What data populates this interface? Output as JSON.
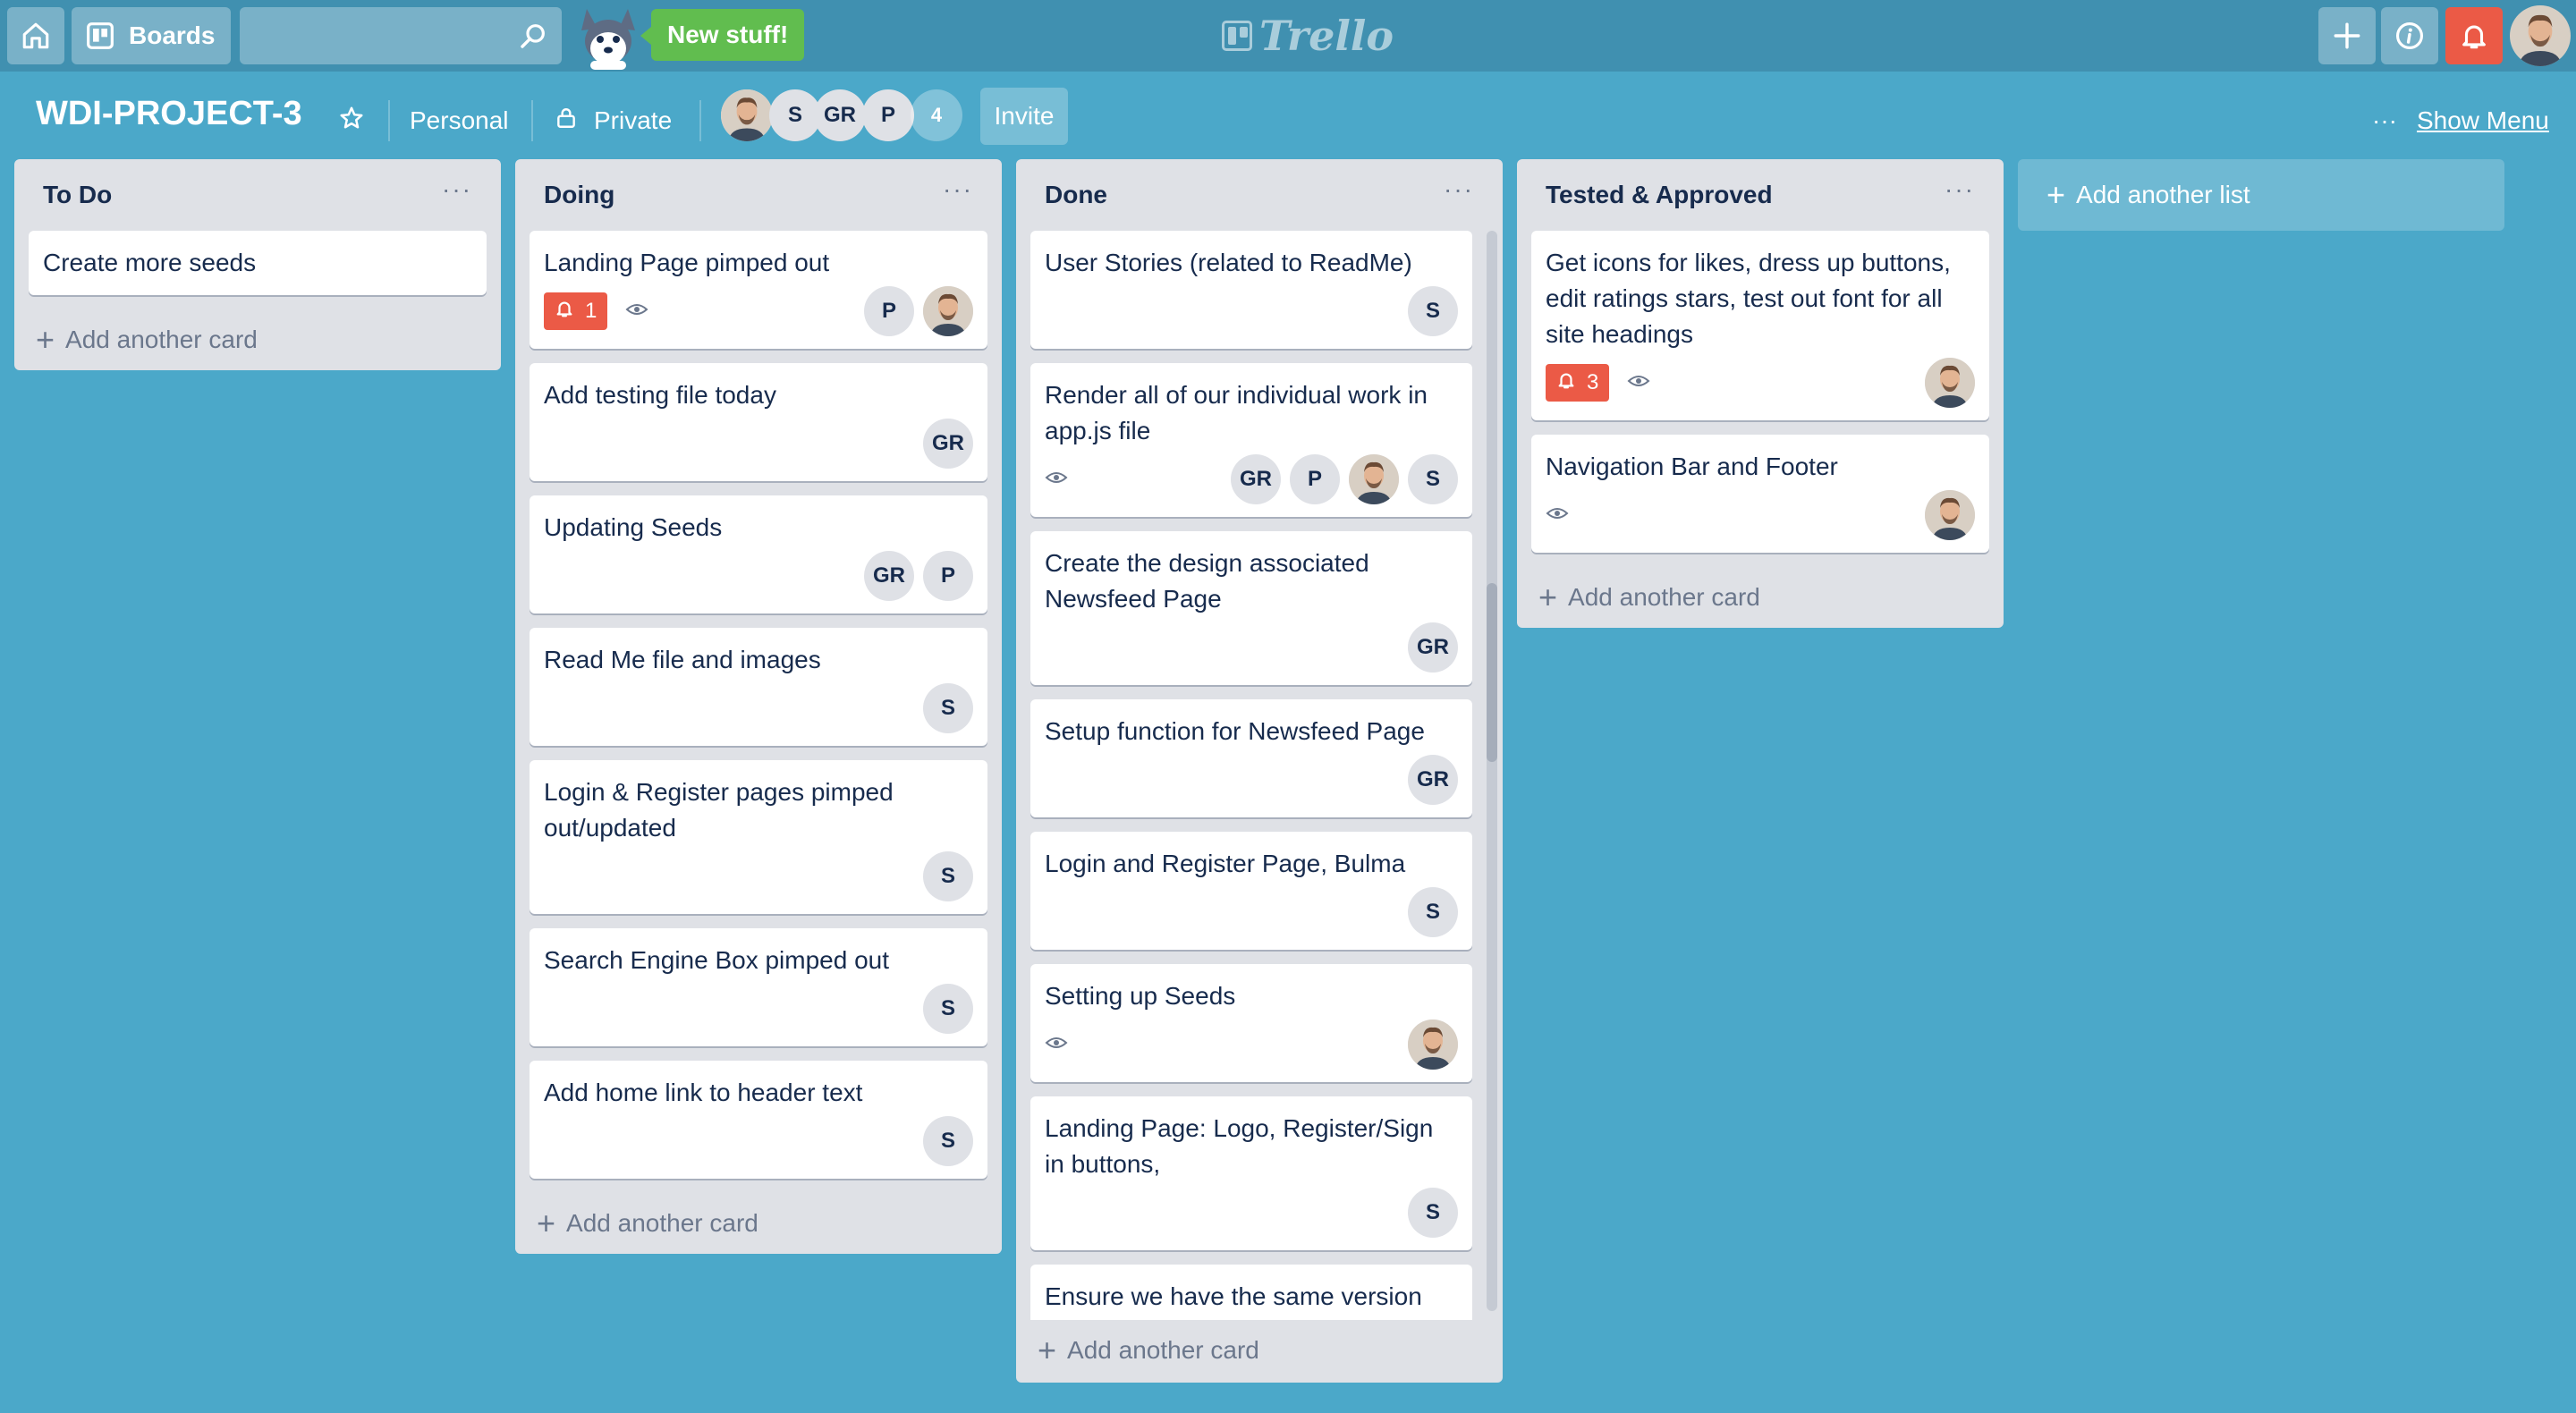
{
  "header": {
    "boards_label": "Boards",
    "search_value": "",
    "new_stuff_label": "New stuff!",
    "logo_text": "Trello",
    "icons": [
      "home-icon",
      "boards-icon",
      "search-icon",
      "plus-icon",
      "info-icon",
      "bell-icon"
    ]
  },
  "board": {
    "title": "WDI-PROJECT-3",
    "team": "Personal",
    "visibility": "Private",
    "members": [
      "S",
      "GR",
      "P"
    ],
    "member_count": "4",
    "invite_label": "Invite",
    "menu_dots": "···",
    "show_menu_label": "Show Menu"
  },
  "colors": {
    "background": "#4ba8c9",
    "header": "#4090b0",
    "list_bg": "#dfe1e6",
    "badge_red": "#eb5a46",
    "new_stuff_green": "#61bd4f"
  },
  "common": {
    "add_card_label": "Add another card",
    "add_list_label": "Add another list",
    "list_menu": "···"
  },
  "lists": [
    {
      "title": "To Do",
      "cards": [
        {
          "title": "Create more seeds"
        }
      ]
    },
    {
      "title": "Doing",
      "cards": [
        {
          "title": "Landing Page pimped out",
          "notif": "1",
          "watch": true,
          "members": [
            "P",
            "photo"
          ]
        },
        {
          "title": "Add testing file today",
          "members": [
            "GR"
          ]
        },
        {
          "title": "Updating Seeds",
          "members": [
            "GR",
            "P"
          ]
        },
        {
          "title": "Read Me file and images",
          "members": [
            "S"
          ]
        },
        {
          "title": "Login & Register pages pimped out/updated",
          "members": [
            "S"
          ]
        },
        {
          "title": "Search Engine Box pimped out",
          "members": [
            "S"
          ]
        },
        {
          "title": "Add home link to header text",
          "members": [
            "S"
          ]
        }
      ]
    },
    {
      "title": "Done",
      "cards": [
        {
          "title": "User Stories (related to ReadMe)",
          "members": [
            "S"
          ]
        },
        {
          "title": "Render all of our individual work in app.js file",
          "watch": true,
          "members": [
            "GR",
            "P",
            "photo",
            "S"
          ]
        },
        {
          "title": "Create the design associated Newsfeed Page",
          "members": [
            "GR"
          ]
        },
        {
          "title": "Setup function for Newsfeed Page",
          "members": [
            "GR"
          ]
        },
        {
          "title": "Login and Register Page, Bulma",
          "members": [
            "S"
          ]
        },
        {
          "title": "Setting up Seeds",
          "watch": true,
          "members": [
            "photo"
          ]
        },
        {
          "title": "Landing Page: Logo, Register/Sign in buttons,",
          "members": [
            "S"
          ]
        },
        {
          "title": "Ensure we have the same version via Git"
        }
      ]
    },
    {
      "title": "Tested & Approved",
      "cards": [
        {
          "title": "Get icons for likes, dress up buttons, edit ratings stars, test out font for all site headings",
          "notif": "3",
          "watch": true,
          "members": [
            "photo"
          ]
        },
        {
          "title": "Navigation Bar and Footer",
          "watch": true,
          "members": [
            "photo"
          ]
        }
      ]
    }
  ]
}
